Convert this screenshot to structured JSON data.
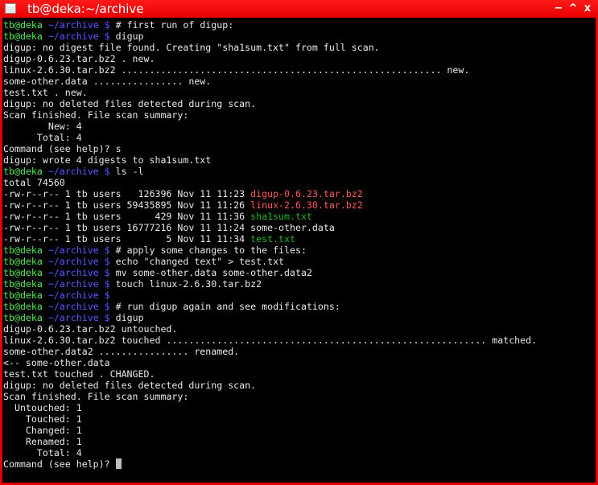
{
  "window": {
    "title": "tb@deka:~/archive",
    "buttons": {
      "minimize": "−",
      "maximize": "^",
      "close": "x"
    }
  },
  "prompt": {
    "user": "tb@deka",
    "path": " ~/archive $ "
  },
  "colors": {
    "frame": "#e00000",
    "user": "#55e855",
    "path": "#5a5aff",
    "red_file": "#ff5a5a",
    "green_file": "#22b422",
    "text": "#e8e8e8"
  },
  "lines": [
    {
      "type": "prompt",
      "cmd": "# first run of digup:"
    },
    {
      "type": "prompt",
      "cmd": "digup"
    },
    {
      "type": "text",
      "text": "digup: no digest file found. Creating \"sha1sum.txt\" from full scan."
    },
    {
      "type": "text",
      "text": "digup-0.6.23.tar.bz2 . new."
    },
    {
      "type": "text",
      "text": "linux-2.6.30.tar.bz2 ......................................................... new."
    },
    {
      "type": "text",
      "text": "some-other.data ................ new."
    },
    {
      "type": "text",
      "text": "test.txt . new."
    },
    {
      "type": "text",
      "text": "digup: no deleted files detected during scan."
    },
    {
      "type": "text",
      "text": "Scan finished. File scan summary:"
    },
    {
      "type": "text",
      "text": "        New: 4"
    },
    {
      "type": "text",
      "text": "      Total: 4"
    },
    {
      "type": "text",
      "text": "Command (see help)? s"
    },
    {
      "type": "text",
      "text": "digup: wrote 4 digests to sha1sum.txt"
    },
    {
      "type": "prompt",
      "cmd": "ls -l"
    },
    {
      "type": "text",
      "text": "total 74560"
    },
    {
      "type": "ls",
      "meta": "-rw-r--r-- 1 tb users   126396 Nov 11 11:23 ",
      "name": "digup-0.6.23.tar.bz2",
      "color": "red"
    },
    {
      "type": "ls",
      "meta": "-rw-r--r-- 1 tb users 59435895 Nov 11 11:26 ",
      "name": "linux-2.6.30.tar.bz2",
      "color": "red"
    },
    {
      "type": "ls",
      "meta": "-rw-r--r-- 1 tb users      429 Nov 11 11:36 ",
      "name": "sha1sum.txt",
      "color": "green"
    },
    {
      "type": "ls",
      "meta": "-rw-r--r-- 1 tb users 16777216 Nov 11 11:24 ",
      "name": "some-other.data",
      "color": "plain"
    },
    {
      "type": "ls",
      "meta": "-rw-r--r-- 1 tb users        5 Nov 11 11:34 ",
      "name": "test.txt",
      "color": "green"
    },
    {
      "type": "prompt",
      "cmd": "# apply some changes to the files:"
    },
    {
      "type": "prompt",
      "cmd": "echo \"changed text\" > test.txt"
    },
    {
      "type": "prompt",
      "cmd": "mv some-other.data some-other.data2"
    },
    {
      "type": "prompt",
      "cmd": "touch linux-2.6.30.tar.bz2"
    },
    {
      "type": "prompt",
      "cmd": ""
    },
    {
      "type": "prompt",
      "cmd": "# run digup again and see modifications:"
    },
    {
      "type": "prompt",
      "cmd": "digup"
    },
    {
      "type": "text",
      "text": "digup-0.6.23.tar.bz2 untouched."
    },
    {
      "type": "text",
      "text": "linux-2.6.30.tar.bz2 touched ......................................................... matched."
    },
    {
      "type": "text",
      "text": "some-other.data2 ................ renamed."
    },
    {
      "type": "text",
      "text": "<-- some-other.data"
    },
    {
      "type": "text",
      "text": "test.txt touched . CHANGED."
    },
    {
      "type": "text",
      "text": "digup: no deleted files detected during scan."
    },
    {
      "type": "text",
      "text": "Scan finished. File scan summary:"
    },
    {
      "type": "text",
      "text": "  Untouched: 1"
    },
    {
      "type": "text",
      "text": "    Touched: 1"
    },
    {
      "type": "text",
      "text": "    Changed: 1"
    },
    {
      "type": "text",
      "text": "    Renamed: 1"
    },
    {
      "type": "text",
      "text": "      Total: 4"
    },
    {
      "type": "input",
      "text": "Command (see help)? "
    }
  ]
}
